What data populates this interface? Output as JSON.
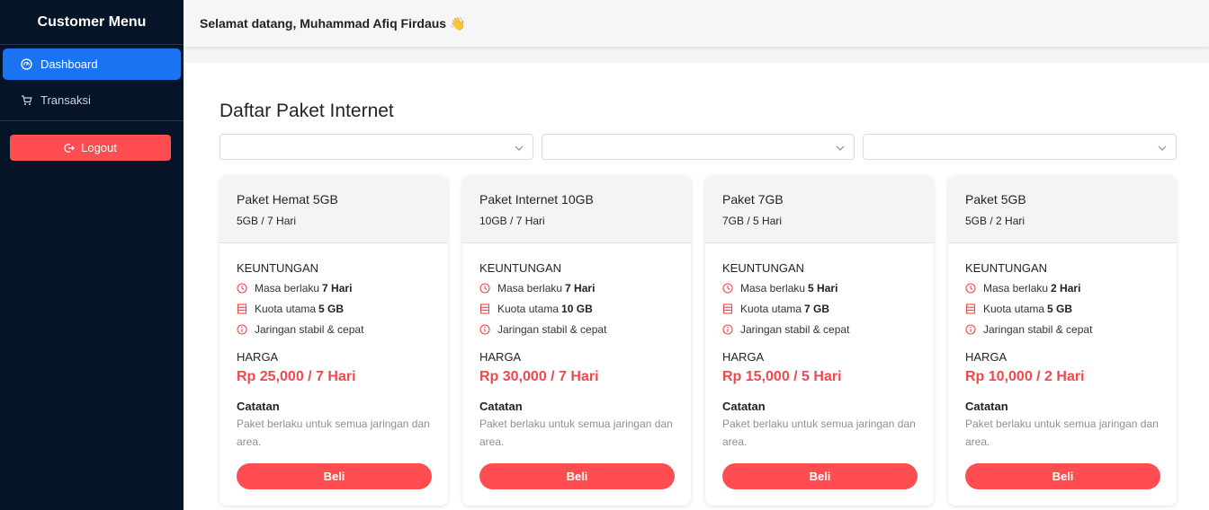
{
  "sidebar": {
    "title": "Customer Menu",
    "items": [
      {
        "label": "Dashboard",
        "icon": "dashboard-icon"
      },
      {
        "label": "Transaksi",
        "icon": "cart-icon"
      }
    ],
    "logout_label": "Logout"
  },
  "topbar": {
    "greeting": "Selamat datang, Muhammad Afiq Firdaus 👋"
  },
  "main": {
    "title": "Daftar Paket Internet",
    "filters": [
      {
        "value": ""
      },
      {
        "value": ""
      },
      {
        "value": ""
      }
    ]
  },
  "labels": {
    "benefits": "KEUNTUNGAN",
    "price": "HARGA",
    "note": "Catatan",
    "validity_prefix": "Masa berlaku",
    "quota_prefix": "Kuota utama",
    "network": "Jaringan stabil & cepat",
    "buy": "Beli"
  },
  "packages": [
    {
      "name": "Paket Hemat 5GB",
      "summary": "5GB / 7 Hari",
      "validity": "7 Hari",
      "quota": "5 GB",
      "price": "Rp 25,000 / 7 Hari",
      "note": "Paket berlaku untuk semua jaringan dan area."
    },
    {
      "name": "Paket Internet 10GB",
      "summary": "10GB / 7 Hari",
      "validity": "7 Hari",
      "quota": "10 GB",
      "price": "Rp 30,000 / 7 Hari",
      "note": "Paket berlaku untuk semua jaringan dan area."
    },
    {
      "name": "Paket 7GB",
      "summary": "7GB / 5 Hari",
      "validity": "5 Hari",
      "quota": "7 GB",
      "price": "Rp 15,000 / 5 Hari",
      "note": "Paket berlaku untuk semua jaringan dan area."
    },
    {
      "name": "Paket 5GB",
      "summary": "5GB / 2 Hari",
      "validity": "2 Hari",
      "quota": "5 GB",
      "price": "Rp 10,000 / 2 Hari",
      "note": "Paket berlaku untuk semua jaringan dan area."
    }
  ],
  "colors": {
    "sidebar_bg": "#061428",
    "accent_blue": "#1a73f0",
    "accent_red": "#ff4d52"
  }
}
